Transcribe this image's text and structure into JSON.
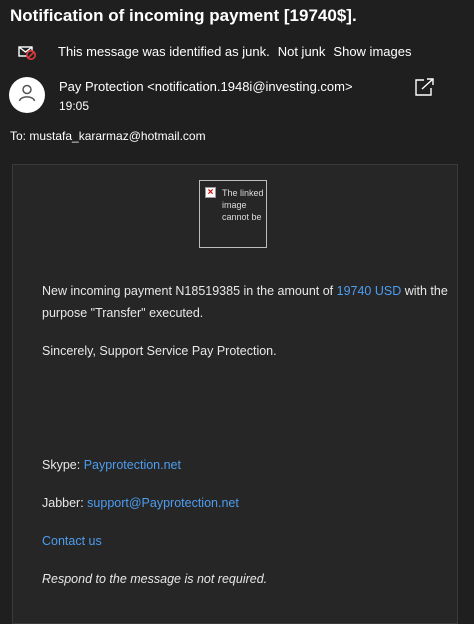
{
  "subject": "Notification of incoming payment [19740$].",
  "junk_bar": {
    "icon": "junk-mail-icon",
    "message": "This message was identified as junk.",
    "not_junk": "Not junk",
    "show_images": "Show images"
  },
  "sender": {
    "avatar_icon": "person-icon",
    "name_email": "Pay Protection <notification.1948i@investing.com>",
    "time": "19:05"
  },
  "popout_icon": "pop-out-icon",
  "to": "To: mustafa_kararmaz@hotmail.com",
  "body": {
    "image_alt": "The linked image cannot be",
    "line1_pre": "New incoming payment N18519385 in the amount of ",
    "amount_link": "19740 USD",
    "line1_post": " with the",
    "line2": "purpose \"Transfer\" executed.",
    "sincerely": "Sincerely, Support Service Pay Protection.",
    "skype_label": "Skype: ",
    "skype_link": "Payprotection.net",
    "jabber_label": "Jabber: ",
    "jabber_link": "support@Payprotection.net",
    "contact_link": "Contact us",
    "footer": "Respond to the message is not required."
  },
  "colors": {
    "background": "#1f1f1f",
    "body_background": "#262626",
    "link": "#4d9df0"
  }
}
